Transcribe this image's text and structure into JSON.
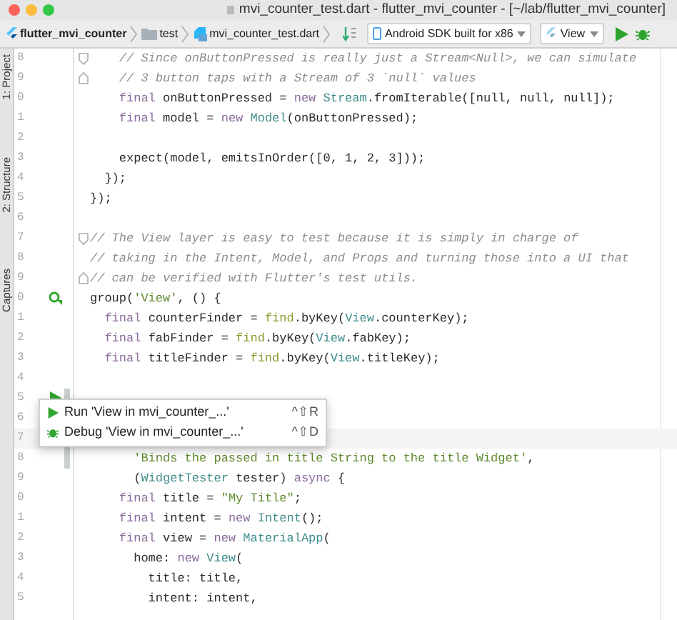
{
  "window": {
    "title": "mvi_counter_test.dart - flutter_mvi_counter - [~/lab/flutter_mvi_counter]"
  },
  "breadcrumbs": [
    {
      "label": "flutter_mvi_counter",
      "kind": "project"
    },
    {
      "label": "test",
      "kind": "folder"
    },
    {
      "label": "mvi_counter_test.dart",
      "kind": "file"
    }
  ],
  "toolbar": {
    "device": "Android SDK built for x86",
    "configuration": "View"
  },
  "tool_strip": [
    {
      "label": "1: Project"
    },
    {
      "label": "2: Structure"
    },
    {
      "label": "Captures"
    }
  ],
  "editor": {
    "lines": [
      {
        "number": "8",
        "marker": {
          "kind": "fold_start"
        },
        "changed": false,
        "current": false,
        "segments": [
          {
            "text": "    // Since onButtonPressed is really just a Stream<Null>, we can simulate",
            "kind": "comment"
          }
        ]
      },
      {
        "number": "9",
        "marker": {
          "kind": "fold_end"
        },
        "changed": false,
        "current": false,
        "segments": [
          {
            "text": "    // 3 button taps with a Stream of 3 `null` values",
            "kind": "comment"
          }
        ]
      },
      {
        "number": "0",
        "changed": false,
        "current": false,
        "segments": [
          {
            "text": "    final",
            "kind": "keyword"
          },
          {
            "text": " onButtonPressed = ",
            "kind": "plain"
          },
          {
            "text": "new ",
            "kind": "keyword"
          },
          {
            "text": "Stream",
            "kind": "type"
          },
          {
            "text": ".fromIterable([null, null, null]);",
            "kind": "plain"
          }
        ]
      },
      {
        "number": "1",
        "changed": false,
        "current": false,
        "segments": [
          {
            "text": "    final",
            "kind": "keyword"
          },
          {
            "text": " model = ",
            "kind": "plain"
          },
          {
            "text": "new ",
            "kind": "keyword"
          },
          {
            "text": "Model",
            "kind": "type"
          },
          {
            "text": "(onButtonPressed);",
            "kind": "plain"
          }
        ]
      },
      {
        "number": "2",
        "changed": false,
        "current": false
      },
      {
        "number": "3",
        "changed": false,
        "current": false,
        "segments": [
          {
            "text": "    expect(model, emitsInOrder([0, 1, 2, 3]));",
            "kind": "plain"
          }
        ]
      },
      {
        "number": "4",
        "changed": false,
        "current": false,
        "segments": [
          {
            "text": "  });",
            "kind": "plain"
          }
        ]
      },
      {
        "number": "5",
        "changed": false,
        "current": false,
        "segments": [
          {
            "text": "});",
            "kind": "plain"
          }
        ]
      },
      {
        "number": "6",
        "changed": false,
        "current": false
      },
      {
        "number": "7",
        "marker": {
          "kind": "fold_start"
        },
        "changed": false,
        "current": false,
        "segments": [
          {
            "text": "// The View layer is easy to test because it is simply in charge of",
            "kind": "comment"
          }
        ]
      },
      {
        "number": "8",
        "changed": false,
        "current": false,
        "segments": [
          {
            "text": "// taking in the Intent, Model, and Props and turning those into a UI that",
            "kind": "comment"
          }
        ]
      },
      {
        "number": "9",
        "marker": {
          "kind": "fold_end"
        },
        "changed": false,
        "current": false,
        "segments": [
          {
            "text": "// can be verified with Flutter's test utils.",
            "kind": "comment"
          }
        ]
      },
      {
        "number": "0",
        "marker": {
          "kind": "run_group"
        },
        "changed": false,
        "current": false,
        "segments": [
          {
            "text": "group(",
            "kind": "plain"
          },
          {
            "text": "'View'",
            "kind": "string"
          },
          {
            "text": ", () {",
            "kind": "plain"
          }
        ]
      },
      {
        "number": "1",
        "changed": false,
        "current": false,
        "segments": [
          {
            "text": "  final",
            "kind": "keyword"
          },
          {
            "text": " counterFinder = ",
            "kind": "plain"
          },
          {
            "text": "find",
            "kind": "call"
          },
          {
            "text": ".byKey(",
            "kind": "plain"
          },
          {
            "text": "View",
            "kind": "type"
          },
          {
            "text": ".counterKey);",
            "kind": "plain"
          }
        ]
      },
      {
        "number": "2",
        "changed": false,
        "current": false,
        "segments": [
          {
            "text": "  final",
            "kind": "keyword"
          },
          {
            "text": " fabFinder = ",
            "kind": "plain"
          },
          {
            "text": "find",
            "kind": "call"
          },
          {
            "text": ".byKey(",
            "kind": "plain"
          },
          {
            "text": "View",
            "kind": "type"
          },
          {
            "text": ".fabKey);",
            "kind": "plain"
          }
        ]
      },
      {
        "number": "3",
        "changed": false,
        "current": false,
        "segments": [
          {
            "text": "  final",
            "kind": "keyword"
          },
          {
            "text": " titleFinder = ",
            "kind": "plain"
          },
          {
            "text": "find",
            "kind": "call"
          },
          {
            "text": ".byKey(",
            "kind": "plain"
          },
          {
            "text": "View",
            "kind": "type"
          },
          {
            "text": ".titleKey);",
            "kind": "plain"
          }
        ]
      },
      {
        "number": "4",
        "changed": false,
        "current": false
      },
      {
        "number": "5",
        "marker": {
          "kind": "run"
        },
        "changed": true,
        "current": false
      },
      {
        "number": "6",
        "changed": true,
        "current": false
      },
      {
        "number": "7",
        "changed": true,
        "current": true
      },
      {
        "number": "8",
        "changed": true,
        "current": false,
        "segments": [
          {
            "text": "      'Binds the passed in title String to the title Widget'",
            "kind": "string"
          },
          {
            "text": ",",
            "kind": "plain"
          }
        ]
      },
      {
        "number": "9",
        "changed": false,
        "current": false,
        "segments": [
          {
            "text": "      (",
            "kind": "plain"
          },
          {
            "text": "WidgetTester",
            "kind": "type"
          },
          {
            "text": " tester) ",
            "kind": "plain"
          },
          {
            "text": "async",
            "kind": "keyword"
          },
          {
            "text": " {",
            "kind": "plain"
          }
        ]
      },
      {
        "number": "0",
        "changed": false,
        "current": false,
        "segments": [
          {
            "text": "    final",
            "kind": "keyword"
          },
          {
            "text": " title = ",
            "kind": "plain"
          },
          {
            "text": "\"My Title\"",
            "kind": "string"
          },
          {
            "text": ";",
            "kind": "plain"
          }
        ]
      },
      {
        "number": "1",
        "changed": false,
        "current": false,
        "segments": [
          {
            "text": "    final",
            "kind": "keyword"
          },
          {
            "text": " intent = ",
            "kind": "plain"
          },
          {
            "text": "new ",
            "kind": "keyword"
          },
          {
            "text": "Intent",
            "kind": "type"
          },
          {
            "text": "();",
            "kind": "plain"
          }
        ]
      },
      {
        "number": "2",
        "changed": false,
        "current": false,
        "segments": [
          {
            "text": "    final",
            "kind": "keyword"
          },
          {
            "text": " view = ",
            "kind": "plain"
          },
          {
            "text": "new ",
            "kind": "keyword"
          },
          {
            "text": "MaterialApp",
            "kind": "type"
          },
          {
            "text": "(",
            "kind": "plain"
          }
        ]
      },
      {
        "number": "3",
        "changed": false,
        "current": false,
        "segments": [
          {
            "text": "      home: ",
            "kind": "plain"
          },
          {
            "text": "new ",
            "kind": "keyword"
          },
          {
            "text": "View",
            "kind": "type"
          },
          {
            "text": "(",
            "kind": "plain"
          }
        ]
      },
      {
        "number": "4",
        "changed": false,
        "current": false,
        "segments": [
          {
            "text": "        title: title,",
            "kind": "plain"
          }
        ]
      },
      {
        "number": "5",
        "changed": false,
        "current": false,
        "segments": [
          {
            "text": "        intent: intent,",
            "kind": "plain"
          }
        ]
      }
    ]
  },
  "popup": {
    "items": [
      {
        "kind": "run",
        "label": "Run 'View in mvi_counter_...'",
        "shortcut": "^⇧R"
      },
      {
        "kind": "debug",
        "label": "Debug 'View in mvi_counter_...'",
        "shortcut": "^⇧D"
      }
    ]
  }
}
